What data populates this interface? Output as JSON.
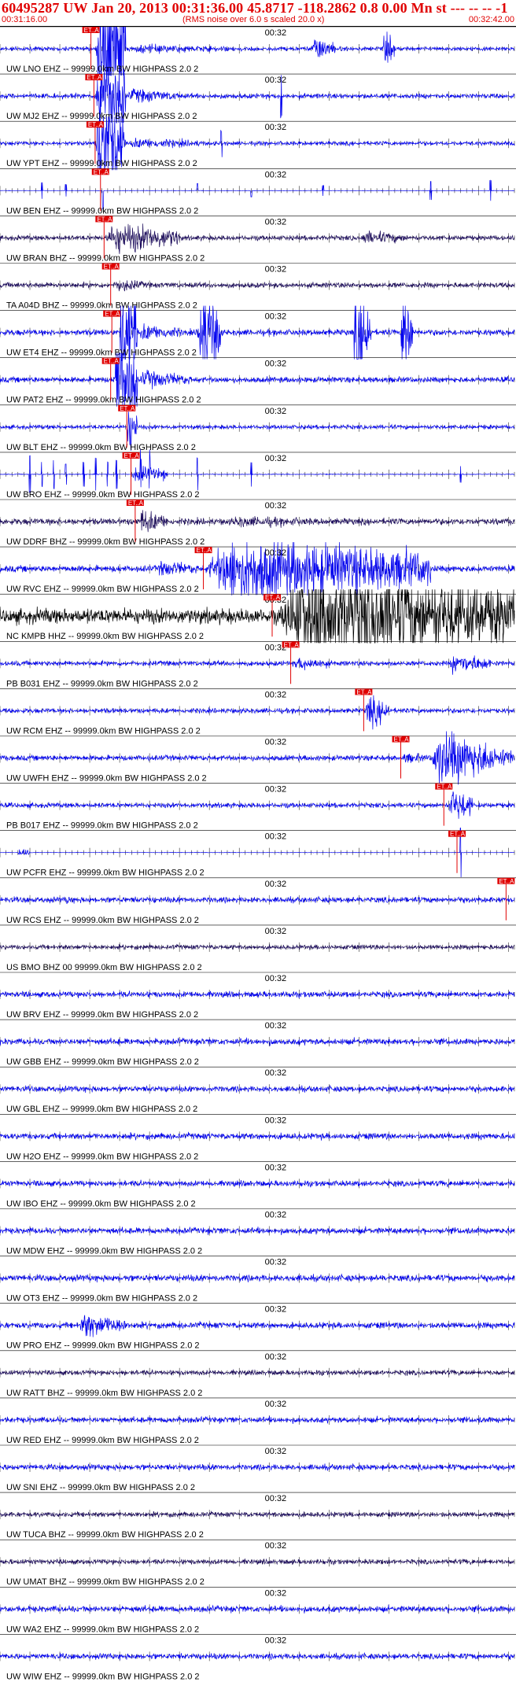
{
  "header": {
    "title": "60495287 UW Jan 20, 2013 00:31:36.00   45.8717 -118.2862  0.8 0.00 Mn st --- -- --  -1",
    "start_time": "00:31:16.00",
    "note": "(RMS noise over 6.0 s scaled 20.0 x)",
    "end_time": "00:32:42.00"
  },
  "chart_data": {
    "type": "line",
    "title": "60495287 UW Jan 20, 2013 00:31:36.00   45.8717 -118.2862  0.8 0.00 Mn st --- -- --  -1",
    "x_range": [
      "00:31:16.00",
      "00:32:42.00"
    ],
    "x_tick_label": "00:32",
    "x_tick_label_time_s": 44,
    "x_duration_s": 86,
    "tick_interval_s": 1,
    "major_tick_interval_s": 5,
    "marker_label": "ET..A",
    "colors": {
      "blue": "#0000ee",
      "purple": "#1a0a5a",
      "black": "#000000",
      "marker": "#e00000"
    },
    "traces": [
      {
        "label": "UW LNO EHZ -- 99999.0km BW  HIGHPASS  2.0  2",
        "color": "blue",
        "pick_s": 15.2,
        "noise": 0.1,
        "events": [
          [
            16,
            21,
            6.0
          ],
          [
            21,
            40,
            0.25
          ],
          [
            52,
            56,
            0.7
          ],
          [
            64,
            66,
            0.9
          ]
        ],
        "spikes": []
      },
      {
        "label": "UW MJ2 EHZ -- 99999.0km BW  HIGHPASS  2.0  2",
        "color": "blue",
        "pick_s": 15.7,
        "noise": 0.12,
        "events": [
          [
            16,
            21,
            4.0
          ],
          [
            21,
            30,
            0.4
          ]
        ],
        "spikes": [
          [
            47,
            1.0
          ]
        ]
      },
      {
        "label": "UW YPT EHZ -- 99999.0km BW  HIGHPASS  2.0  2",
        "color": "blue",
        "pick_s": 15.9,
        "noise": 0.1,
        "events": [
          [
            16,
            21,
            3.5
          ],
          [
            21,
            34,
            0.3
          ]
        ],
        "spikes": [
          [
            37,
            0.6
          ]
        ]
      },
      {
        "label": "UW BEN EHZ -- 99999.0km BW  HIGHPASS  2.0  2",
        "color": "blue",
        "pick_s": 16.8,
        "noise": 0.01,
        "events": [],
        "spikes": [
          [
            7,
            0.4
          ],
          [
            11,
            0.3
          ],
          [
            17.2,
            0.9
          ],
          [
            33,
            0.35
          ],
          [
            42,
            0.3
          ],
          [
            54,
            0.25
          ],
          [
            72,
            0.45
          ],
          [
            82,
            0.5
          ]
        ]
      },
      {
        "label": "UW BRAN BHZ -- 99999.0km BW  HIGHPASS  2.0  2",
        "color": "purple",
        "pick_s": 17.4,
        "noise": 0.12,
        "events": [
          [
            17.5,
            30,
            0.9
          ],
          [
            60,
            68,
            0.4
          ]
        ],
        "spikes": []
      },
      {
        "label": "TA A04D BHZ -- 99999.0km BW  HIGHPASS  2.0  2",
        "color": "purple",
        "pick_s": 18.5,
        "noise": 0.13,
        "events": [
          [
            19,
            24,
            0.4
          ]
        ],
        "spikes": []
      },
      {
        "label": "UW ET4 EHZ -- 99999.0km BW  HIGHPASS  2.0  2",
        "color": "blue",
        "pick_s": 18.7,
        "noise": 0.15,
        "events": [
          [
            20,
            23,
            4.0
          ],
          [
            23,
            30,
            0.5
          ],
          [
            33,
            37,
            3.0
          ],
          [
            59,
            62,
            3.0
          ],
          [
            67,
            69,
            3.0
          ]
        ],
        "spikes": []
      },
      {
        "label": "UW PAT2 EHZ -- 99999.0km BW  HIGHPASS  2.0  2",
        "color": "blue",
        "pick_s": 18.5,
        "noise": 0.14,
        "events": [
          [
            19,
            23,
            4.0
          ],
          [
            23,
            32,
            0.5
          ]
        ],
        "spikes": []
      },
      {
        "label": "UW BLT EHZ -- 99999.0km BW  HIGHPASS  2.0  2",
        "color": "blue",
        "pick_s": 21.2,
        "noise": 0.1,
        "events": [
          [
            21.2,
            23,
            1.5
          ]
        ],
        "spikes": []
      },
      {
        "label": "UW BRO EHZ -- 99999.0km BW  HIGHPASS  2.0  2",
        "color": "blue",
        "pick_s": 21.9,
        "noise": 0.02,
        "events": [
          [
            22,
            28,
            0.5
          ]
        ],
        "spikes": [
          [
            5,
            0.9
          ],
          [
            7,
            0.6
          ],
          [
            9,
            0.7
          ],
          [
            11,
            0.5
          ],
          [
            14,
            0.6
          ],
          [
            16,
            0.8
          ],
          [
            18,
            0.6
          ],
          [
            19.5,
            0.7
          ],
          [
            23.5,
            0.9
          ],
          [
            25,
            0.7
          ],
          [
            33,
            0.8
          ],
          [
            42,
            0.6
          ],
          [
            77,
            0.4
          ]
        ]
      },
      {
        "label": "UW DDRF BHZ -- 99999.0km BW  HIGHPASS  2.0  2",
        "color": "purple",
        "pick_s": 22.6,
        "noise": 0.16,
        "events": [
          [
            23,
            28,
            0.7
          ],
          [
            37,
            58,
            0.3
          ]
        ],
        "spikes": []
      },
      {
        "label": "UW RVC EHZ -- 99999.0km BW  HIGHPASS  2.0  2",
        "color": "blue",
        "pick_s": 34.0,
        "noise": 0.16,
        "events": [
          [
            26,
            34,
            0.45
          ],
          [
            34,
            72,
            1.9
          ]
        ],
        "spikes": []
      },
      {
        "label": "NC KMPB HHZ -- 99999.0km BW  HIGHPASS  2.0  2",
        "color": "black",
        "pick_s": 45.5,
        "noise": 0.38,
        "events": [
          [
            46,
            87,
            3.0
          ]
        ],
        "spikes": []
      },
      {
        "label": "PB B031 EHZ -- 99999.0km BW  HIGHPASS  2.0  2",
        "color": "blue",
        "pick_s": 48.6,
        "noise": 0.12,
        "events": [
          [
            49,
            55,
            0.4
          ],
          [
            75,
            82,
            0.6
          ]
        ],
        "spikes": []
      },
      {
        "label": "UW RCM EHZ -- 99999.0km BW  HIGHPASS  2.0  2",
        "color": "blue",
        "pick_s": 60.8,
        "noise": 0.12,
        "events": [
          [
            61,
            65,
            0.9
          ]
        ],
        "spikes": []
      },
      {
        "label": "UW UWFH EHZ -- 99999.0km BW  HIGHPASS  2.0  2",
        "color": "blue",
        "pick_s": 67.0,
        "noise": 0.13,
        "events": [
          [
            67,
            72,
            0.3
          ],
          [
            72,
            83,
            1.6
          ],
          [
            83,
            87,
            0.6
          ]
        ],
        "spikes": []
      },
      {
        "label": "PB B017 EHZ -- 99999.0km BW  HIGHPASS  2.0  2",
        "color": "blue",
        "pick_s": 74.2,
        "noise": 0.12,
        "events": [
          [
            75,
            79,
            1.0
          ]
        ],
        "spikes": []
      },
      {
        "label": "UW PCFR EHZ -- 99999.0km BW  HIGHPASS  2.0  2",
        "color": "blue",
        "pick_s": 76.4,
        "noise": 0.01,
        "events": [
          [
            3,
            5,
            0.25
          ]
        ],
        "spikes": [
          [
            77,
            1.2
          ]
        ]
      },
      {
        "label": "UW RCS EHZ -- 99999.0km BW  HIGHPASS  2.0  2",
        "color": "blue",
        "pick_s": 84.6,
        "noise": 0.14,
        "events": [
          [
            11,
            12,
            0.3
          ]
        ],
        "spikes": []
      },
      {
        "label": "US BMO BHZ 00 99999.0km BW  HIGHPASS  2.0  2",
        "color": "purple",
        "pick_s": null,
        "noise": 0.11,
        "events": [],
        "spikes": []
      },
      {
        "label": "UW BRV EHZ -- 99999.0km BW  HIGHPASS  2.0  2",
        "color": "blue",
        "pick_s": null,
        "noise": 0.14,
        "events": [],
        "spikes": []
      },
      {
        "label": "UW GBB EHZ -- 99999.0km BW  HIGHPASS  2.0  2",
        "color": "blue",
        "pick_s": null,
        "noise": 0.15,
        "events": [],
        "spikes": []
      },
      {
        "label": "UW GBL EHZ -- 99999.0km BW  HIGHPASS  2.0  2",
        "color": "blue",
        "pick_s": null,
        "noise": 0.14,
        "events": [],
        "spikes": []
      },
      {
        "label": "UW H2O EHZ -- 99999.0km BW  HIGHPASS  2.0  2",
        "color": "blue",
        "pick_s": null,
        "noise": 0.15,
        "events": [],
        "spikes": []
      },
      {
        "label": "UW IBO EHZ -- 99999.0km BW  HIGHPASS  2.0  2",
        "color": "blue",
        "pick_s": null,
        "noise": 0.14,
        "events": [],
        "spikes": []
      },
      {
        "label": "UW MDW EHZ -- 99999.0km BW  HIGHPASS  2.0  2",
        "color": "blue",
        "pick_s": null,
        "noise": 0.15,
        "events": [],
        "spikes": []
      },
      {
        "label": "UW OT3 EHZ -- 99999.0km BW  HIGHPASS  2.0  2",
        "color": "blue",
        "pick_s": null,
        "noise": 0.16,
        "events": [],
        "spikes": []
      },
      {
        "label": "UW PRO EHZ -- 99999.0km BW  HIGHPASS  2.0  2",
        "color": "blue",
        "pick_s": null,
        "noise": 0.15,
        "events": [
          [
            13,
            21,
            0.7
          ]
        ],
        "spikes": []
      },
      {
        "label": "UW RATT BHZ -- 99999.0km BW  HIGHPASS  2.0  2",
        "color": "purple",
        "pick_s": null,
        "noise": 0.12,
        "events": [],
        "spikes": []
      },
      {
        "label": "UW RED EHZ -- 99999.0km BW  HIGHPASS  2.0  2",
        "color": "blue",
        "pick_s": null,
        "noise": 0.14,
        "events": [],
        "spikes": []
      },
      {
        "label": "UW SNI EHZ -- 99999.0km BW  HIGHPASS  2.0  2",
        "color": "blue",
        "pick_s": null,
        "noise": 0.14,
        "events": [],
        "spikes": []
      },
      {
        "label": "UW TUCA BHZ -- 99999.0km BW  HIGHPASS  2.0  2",
        "color": "purple",
        "pick_s": null,
        "noise": 0.12,
        "events": [],
        "spikes": []
      },
      {
        "label": "UW UMAT BHZ -- 99999.0km BW  HIGHPASS  2.0  2",
        "color": "purple",
        "pick_s": null,
        "noise": 0.12,
        "events": [],
        "spikes": []
      },
      {
        "label": "UW WA2 EHZ -- 99999.0km BW  HIGHPASS  2.0  2",
        "color": "blue",
        "pick_s": null,
        "noise": 0.15,
        "events": [],
        "spikes": []
      },
      {
        "label": "UW WIW EHZ -- 99999.0km BW  HIGHPASS  2.0  2",
        "color": "blue",
        "pick_s": null,
        "noise": 0.14,
        "events": [],
        "spikes": []
      }
    ]
  }
}
